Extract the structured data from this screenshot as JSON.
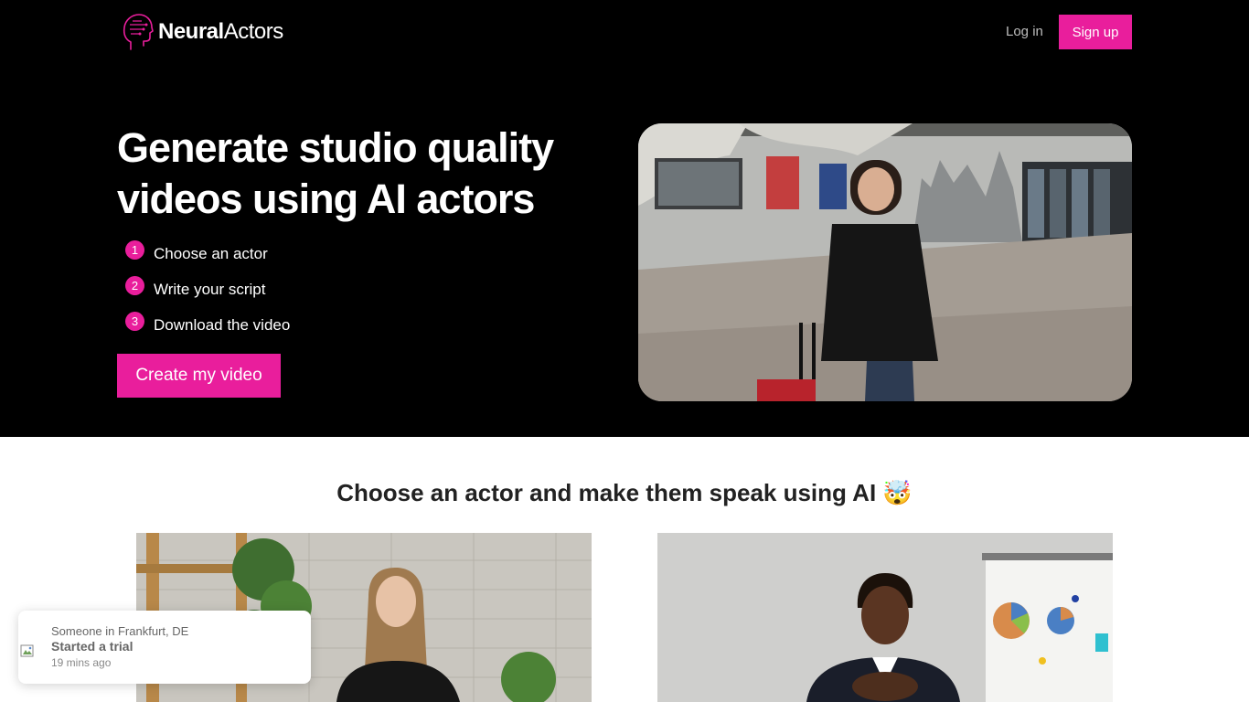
{
  "header": {
    "logo_bold": "Neural",
    "logo_light": "Actors",
    "login_label": "Log in",
    "signup_label": "Sign up"
  },
  "hero": {
    "headline_line1": "Generate studio quality",
    "headline_line2": "videos using AI actors",
    "steps": [
      {
        "number": "1",
        "label": "Choose an actor"
      },
      {
        "number": "2",
        "label": "Write your script"
      },
      {
        "number": "3",
        "label": "Download the video"
      }
    ],
    "cta_label": "Create my video"
  },
  "actors_section": {
    "title": "Choose an actor and make them speak using AI",
    "title_emoji": "🤯"
  },
  "toast": {
    "location": "Someone in Frankfurt, DE",
    "action": "Started a trial",
    "time": "19 mins ago"
  },
  "colors": {
    "accent": "#e91e9c",
    "hero_bg": "#000000"
  },
  "icons": [
    "neural-head-logo-icon",
    "exploding-head-emoji-icon",
    "broken-image-icon"
  ]
}
